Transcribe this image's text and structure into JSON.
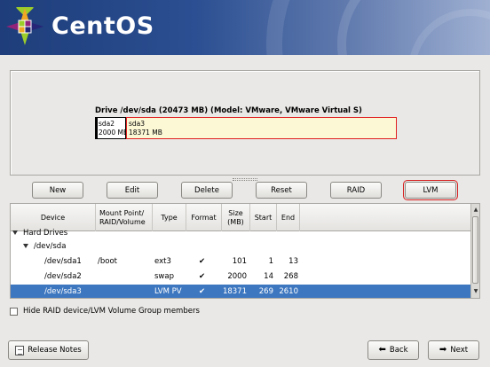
{
  "header": {
    "logo_text": "CentOS",
    "colors": {
      "banner_start": "#1e3d7a",
      "banner_end": "#9fb0d2"
    }
  },
  "drive": {
    "title": "Drive /dev/sda (20473 MB) (Model: VMware, VMware Virtual S)",
    "segments": [
      {
        "name": "sda2",
        "size": "2000 MB"
      },
      {
        "name": "sda3",
        "size": "18371 MB"
      }
    ]
  },
  "actions": {
    "new": "New",
    "edit": "Edit",
    "delete": "Delete",
    "reset": "Reset",
    "raid": "RAID",
    "lvm": "LVM"
  },
  "table": {
    "columns": {
      "device": "Device",
      "mount": "Mount Point/ RAID/Volume",
      "type": "Type",
      "format": "Format",
      "size": "Size (MB)",
      "start": "Start",
      "end": "End"
    },
    "groups": {
      "hard_drives": "Hard Drives",
      "dev_sda": "/dev/sda"
    },
    "rows": [
      {
        "device": "/dev/sda1",
        "mount": "/boot",
        "type": "ext3",
        "format": "✔",
        "size": "101",
        "start": "1",
        "end": "13"
      },
      {
        "device": "/dev/sda2",
        "mount": "",
        "type": "swap",
        "format": "✔",
        "size": "2000",
        "start": "14",
        "end": "268"
      },
      {
        "device": "/dev/sda3",
        "mount": "",
        "type": "LVM PV",
        "format": "✔",
        "size": "18371",
        "start": "269",
        "end": "2610"
      }
    ],
    "selected_color": "#3d77c0"
  },
  "options": {
    "hide_members_label": "Hide RAID device/LVM Volume Group members",
    "hide_members_checked": false
  },
  "footer": {
    "release_notes": "Release Notes",
    "back": "Back",
    "next": "Next"
  }
}
